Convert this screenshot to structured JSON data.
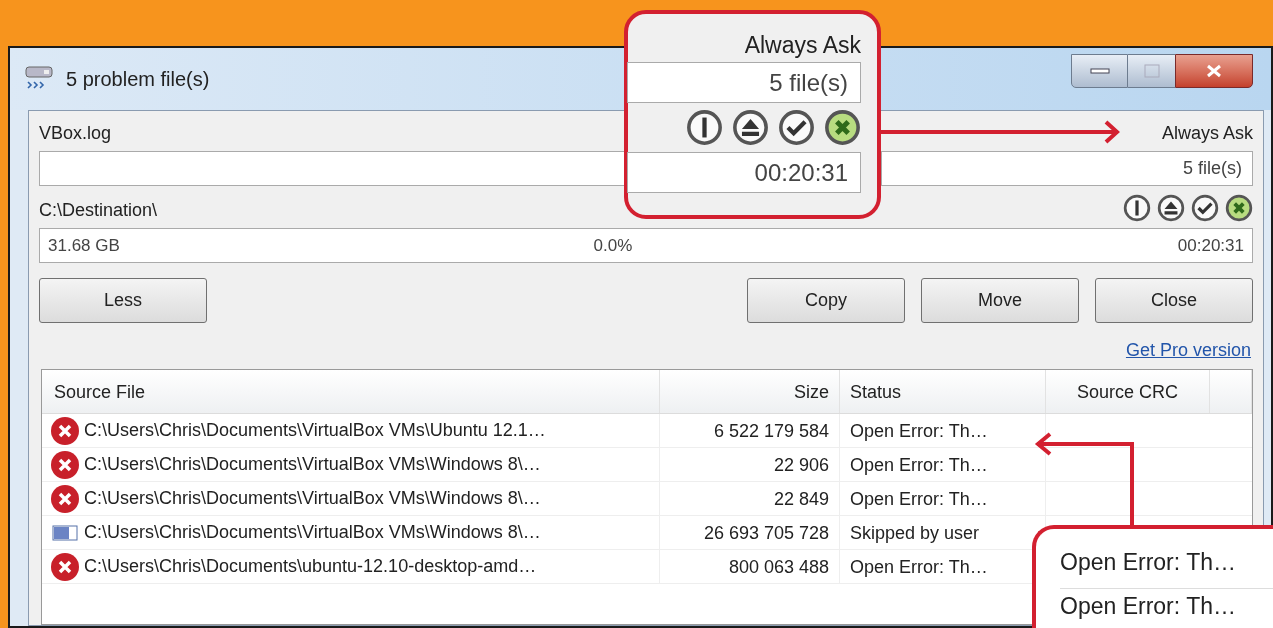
{
  "window": {
    "title": "5 problem file(s)"
  },
  "source": {
    "name": "VBox.log",
    "mode": "Always Ask",
    "files": "5 file(s)"
  },
  "destination": {
    "path": "C:\\Destination\\",
    "free": "31.68 GB",
    "progress": "0.0%",
    "time": "00:20:31"
  },
  "buttons": [
    {
      "label": "Less"
    },
    {
      "label": "Copy"
    },
    {
      "label": "Move"
    },
    {
      "label": "Close"
    }
  ],
  "link": "Get Pro version",
  "table": {
    "columns": [
      "Source File",
      "Size",
      "Status",
      "Source CRC"
    ],
    "rows": [
      {
        "kind": "error",
        "source": "C:\\Users\\Chris\\Documents\\VirtualBox VMs\\Ubuntu 12.1…",
        "size": "6 522 179 584",
        "status": "Open Error: Th…"
      },
      {
        "kind": "error",
        "source": "C:\\Users\\Chris\\Documents\\VirtualBox VMs\\Windows 8\\…",
        "size": "22 906",
        "status": "Open Error: Th…"
      },
      {
        "kind": "error",
        "source": "C:\\Users\\Chris\\Documents\\VirtualBox VMs\\Windows 8\\…",
        "size": "22 849",
        "status": "Open Error: Th…"
      },
      {
        "kind": "skipped",
        "source": "C:\\Users\\Chris\\Documents\\VirtualBox VMs\\Windows 8\\…",
        "size": "26 693 705 728",
        "status": "Skipped by user"
      },
      {
        "kind": "error",
        "source": "C:\\Users\\Chris\\Documents\\ubuntu-12.10-desktop-amd…",
        "size": "800 063 488",
        "status": "Open Error: Th…"
      }
    ]
  },
  "callouts": [
    {
      "kind": "controls",
      "mode": "Always Ask",
      "files": "5 file(s)",
      "time": "00:20:31"
    },
    {
      "kind": "status",
      "lines": [
        "Open Error: Th…",
        "Open Error: Th…"
      ]
    }
  ]
}
